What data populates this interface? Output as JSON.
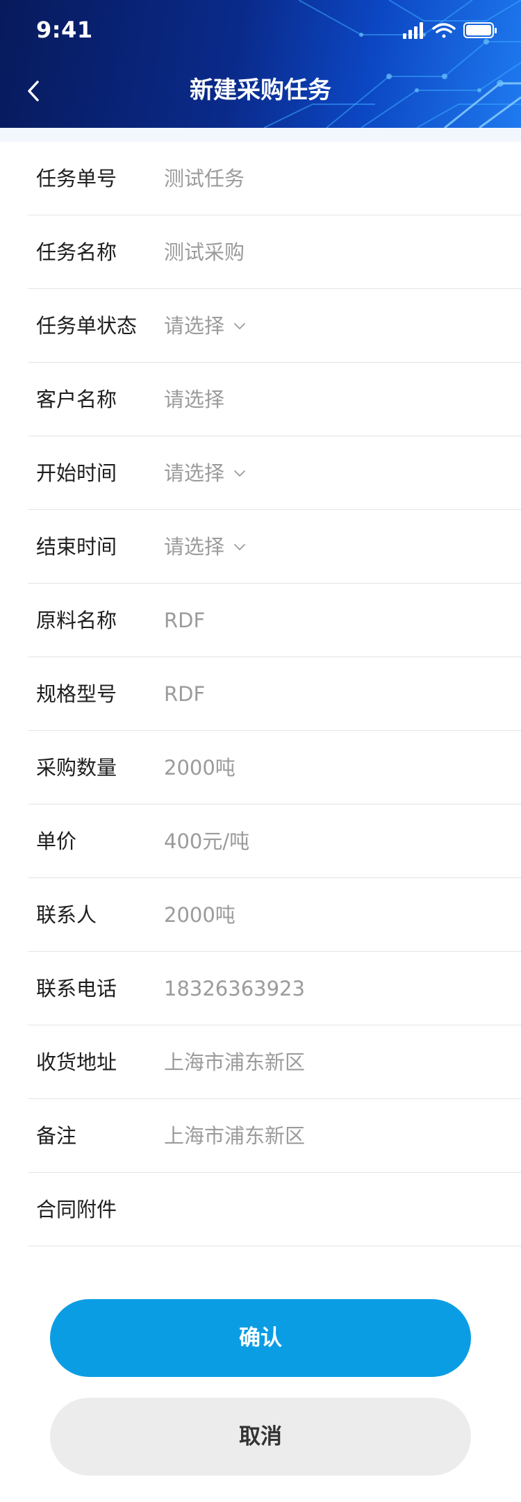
{
  "status_bar": {
    "time": "9:41",
    "icons": [
      "cellular-signal-icon",
      "wifi-icon",
      "battery-icon"
    ]
  },
  "header": {
    "back_icon": "chevron-left-icon",
    "title": "新建采购任务"
  },
  "form": {
    "fields": [
      {
        "label": "任务单号",
        "value": "测试任务",
        "dropdown": false
      },
      {
        "label": "任务名称",
        "value": "测试采购",
        "dropdown": false
      },
      {
        "label": "任务单状态",
        "value": "请选择",
        "dropdown": true
      },
      {
        "label": "客户名称",
        "value": "请选择",
        "dropdown": false
      },
      {
        "label": "开始时间",
        "value": "请选择",
        "dropdown": true
      },
      {
        "label": "结束时间",
        "value": "请选择",
        "dropdown": true
      },
      {
        "label": "原料名称",
        "value": "RDF",
        "dropdown": false
      },
      {
        "label": "规格型号",
        "value": "RDF",
        "dropdown": false
      },
      {
        "label": "采购数量",
        "value": "2000吨",
        "dropdown": false
      },
      {
        "label": "单价",
        "value": "400元/吨",
        "dropdown": false
      },
      {
        "label": "联系人",
        "value": "2000吨",
        "dropdown": false
      },
      {
        "label": "联系电话",
        "value": "18326363923",
        "dropdown": false
      },
      {
        "label": "收货地址",
        "value": "上海市浦东新区",
        "dropdown": false
      },
      {
        "label": "备注",
        "value": "上海市浦东新区",
        "dropdown": false
      },
      {
        "label": "合同附件",
        "value": "",
        "dropdown": false
      }
    ]
  },
  "actions": {
    "confirm_label": "确认",
    "cancel_label": "取消"
  },
  "colors": {
    "header_dark": "#071a5b",
    "header_light": "#1f7af0",
    "primary_button": "#0b9de4",
    "secondary_button": "#ececec",
    "label_text": "#1e1e1e",
    "value_text": "#9b9b9b",
    "divider": "#e4e4e4"
  }
}
